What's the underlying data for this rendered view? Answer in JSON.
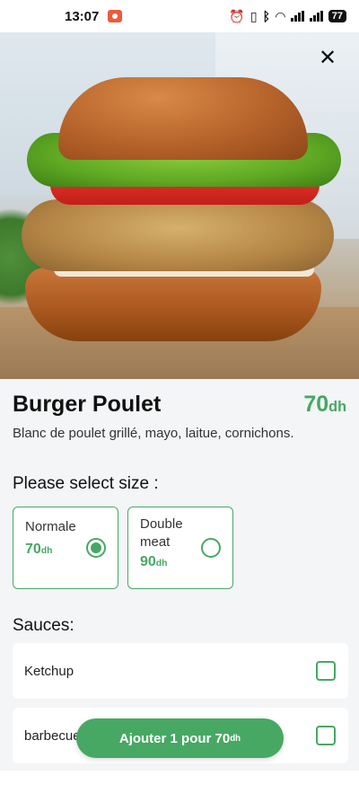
{
  "status_bar": {
    "time": "13:07",
    "battery": "77",
    "icons": [
      "recording-icon",
      "alarm-icon",
      "vibrate-icon",
      "bluetooth-icon",
      "wifi-icon",
      "signal-icon",
      "signal-icon",
      "battery-icon"
    ]
  },
  "product": {
    "name": "Burger Poulet",
    "price_value": "70",
    "currency": "dh",
    "description": "Blanc de poulet grillé, mayo, laitue, cornichons.",
    "image": "burger-photo"
  },
  "size_section": {
    "heading": "Please select size :",
    "options": [
      {
        "label": "Normale",
        "price_value": "70",
        "currency": "dh",
        "selected": true
      },
      {
        "label": "Double meat",
        "price_value": "90",
        "currency": "dh",
        "selected": false
      }
    ]
  },
  "sauces_section": {
    "heading": "Sauces:",
    "items": [
      {
        "name": "Ketchup",
        "checked": false
      },
      {
        "name": "barbecue",
        "checked": false
      }
    ]
  },
  "cta": {
    "label": "Ajouter 1 pour 70",
    "currency": "dh"
  },
  "colors": {
    "accent": "#47a863",
    "background": "#f3f5f7"
  }
}
